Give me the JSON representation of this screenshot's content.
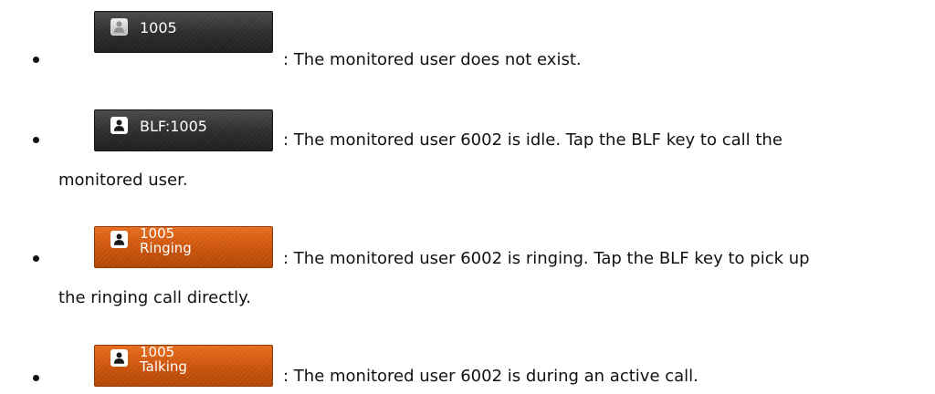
{
  "items": [
    {
      "key_line1": "1005",
      "key_line2": "",
      "key_style": "dark",
      "avatar_style": "gray",
      "description": ": The monitored user does not exist.",
      "description_cont": ""
    },
    {
      "key_line1": "BLF:1005",
      "key_line2": "",
      "key_style": "dark",
      "avatar_style": "white",
      "description": ": The monitored user 6002 is idle. Tap the BLF key to call the",
      "description_cont": "monitored user."
    },
    {
      "key_line1": "1005",
      "key_line2": "Ringing",
      "key_style": "orange",
      "avatar_style": "white",
      "description": ": The monitored user 6002 is ringing. Tap the BLF key to pick up",
      "description_cont": "the ringing call directly."
    },
    {
      "key_line1": "1005",
      "key_line2": "Talking",
      "key_style": "orange",
      "avatar_style": "white",
      "description": ": The monitored user 6002 is during an active call.",
      "description_cont": ""
    }
  ],
  "colors": {
    "dark_key": "#2c2c2c",
    "orange_key": "#c9520b",
    "text": "#111111"
  },
  "icons": {
    "bullet": "bullet-dot",
    "avatar": "contact-avatar-icon"
  }
}
